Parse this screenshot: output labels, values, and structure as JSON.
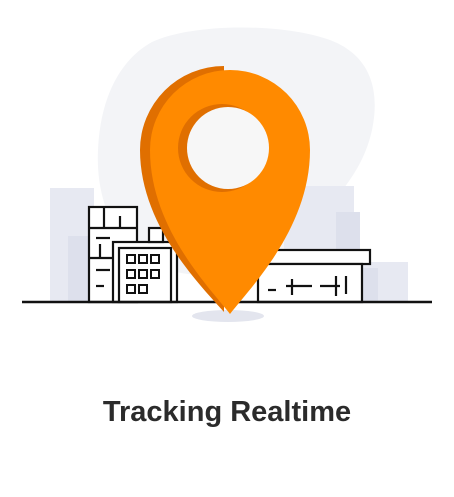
{
  "caption": {
    "text": "Tracking Realtime"
  },
  "illustration": {
    "icon": "map-pin-icon",
    "colors": {
      "pin_main": "#FF8A00",
      "pin_shade": "#E06F00",
      "pin_hole": "#F7F7F7",
      "building_outline": "#111111",
      "background_blob": "#F3F4F7",
      "background_blocks": "#E7E9F2",
      "ground_shadow": "#E3E5EE"
    }
  }
}
